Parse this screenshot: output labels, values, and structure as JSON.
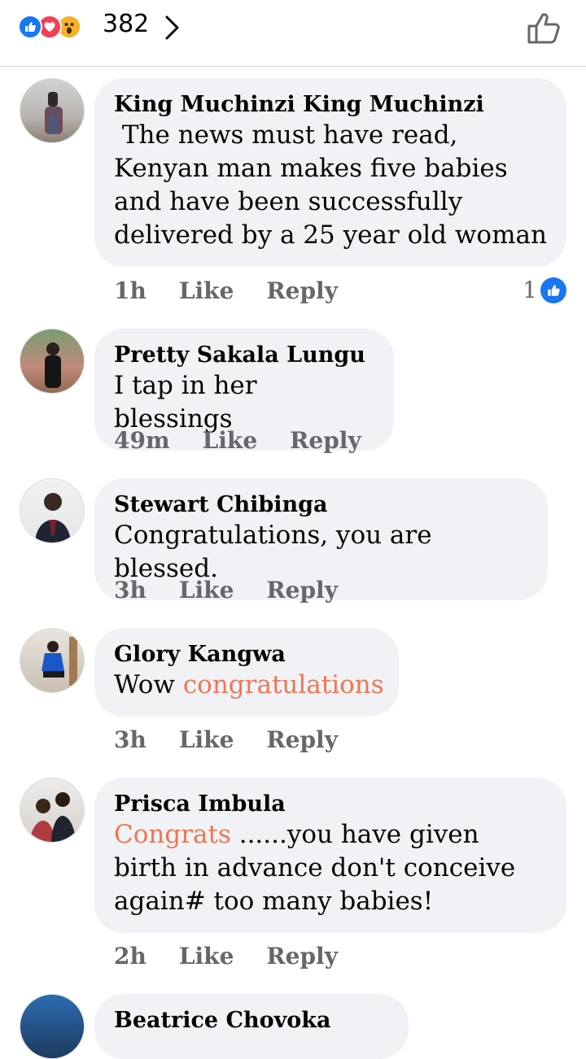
{
  "header": {
    "reaction_count": "382",
    "reactions": [
      "like-icon",
      "love-icon",
      "wow-icon"
    ]
  },
  "comments": [
    {
      "author": "King Muchinzi King Muchinzi",
      "text": " The news must have read, Kenyan man makes five babies and have been successfully delivered by a 25 year old woman",
      "time": "1h",
      "like": "Like",
      "reply": "Reply",
      "reactions": "1"
    },
    {
      "author": "Pretty Sakala Lungu",
      "text": "I tap in her blessings",
      "time": "49m",
      "like": "Like",
      "reply": "Reply"
    },
    {
      "author": "Stewart Chibinga",
      "text": "Congratulations, you are blessed.",
      "time": "3h",
      "like": "Like",
      "reply": "Reply"
    },
    {
      "author": "Glory Kangwa",
      "text_prefix": "Wow ",
      "text_highlight": "congratulations",
      "time": "3h",
      "like": "Like",
      "reply": "Reply"
    },
    {
      "author": "Prisca Imbula",
      "text_highlight": "Congrats",
      "text_rest": " ......you have given birth in advance don't conceive again# too many babies!",
      "time": "2h",
      "like": "Like",
      "reply": "Reply"
    },
    {
      "author": "Beatrice Chovoka"
    }
  ],
  "colors": {
    "bubble": "#f0f2f5",
    "meta": "#65676b",
    "highlight": "#ef7553",
    "like_blue": "#1877f2"
  }
}
